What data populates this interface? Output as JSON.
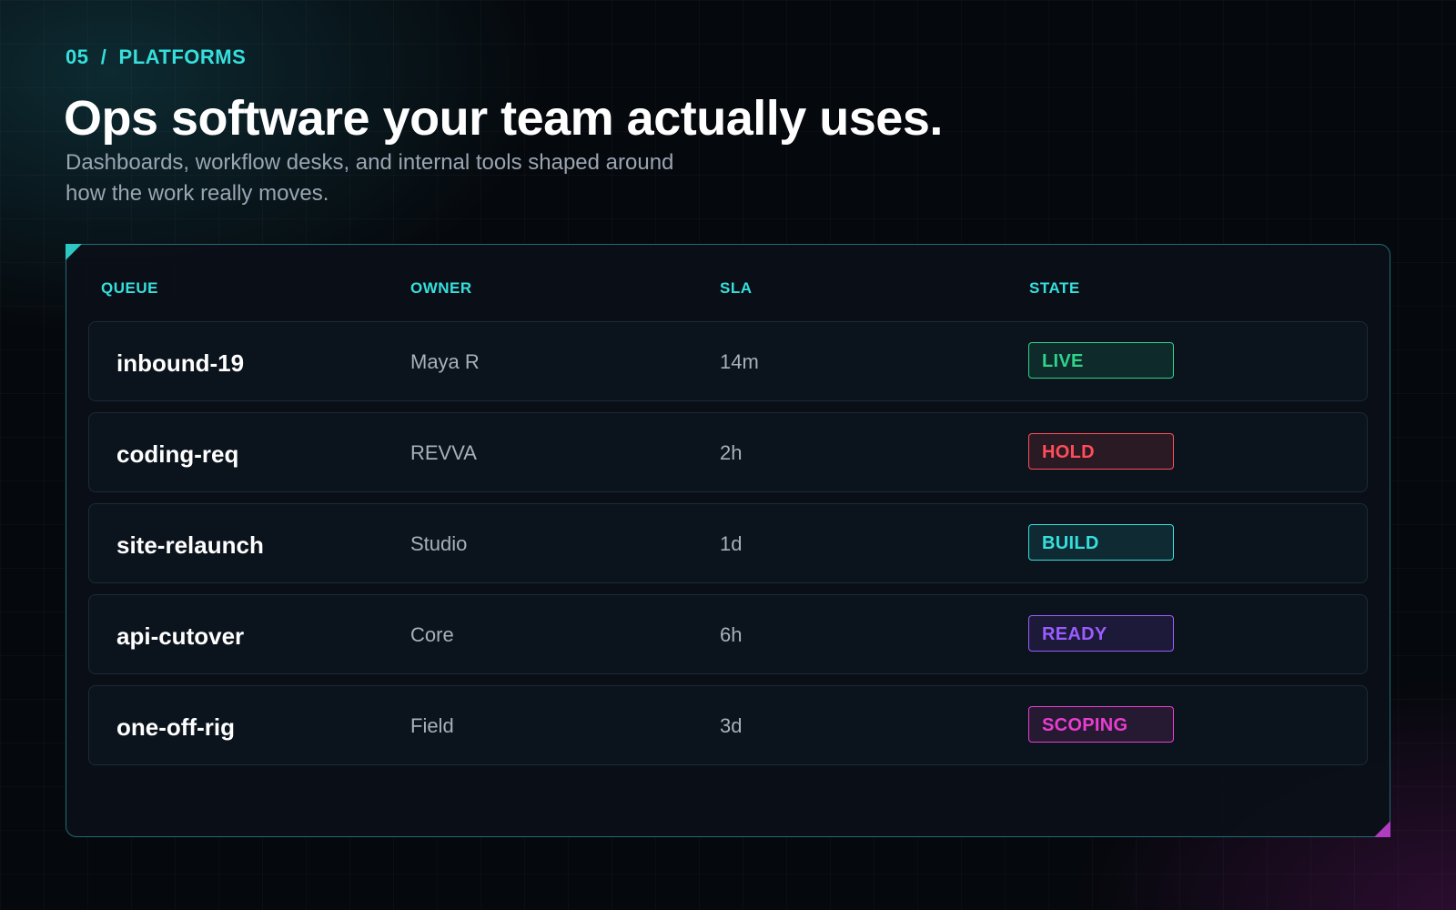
{
  "header": {
    "eyebrow": "05  /  PLATFORMS",
    "title": "Ops software your team actually uses.",
    "subtitle": "Dashboards, workflow desks, and internal tools shaped around how the work really moves."
  },
  "table": {
    "columns": {
      "queue": "QUEUE",
      "owner": "OWNER",
      "sla": "SLA",
      "state": "STATE"
    },
    "rows": [
      {
        "queue": "inbound-19",
        "owner": "Maya R",
        "sla": "14m",
        "state": "LIVE",
        "state_color": "#2fd38a",
        "state_bg": "#0f2a2b"
      },
      {
        "queue": "coding-req",
        "owner": "REVVA",
        "sla": "2h",
        "state": "HOLD",
        "state_color": "#ff4d5a",
        "state_bg": "#2a1a24"
      },
      {
        "queue": "site-relaunch",
        "owner": "Studio",
        "sla": "1d",
        "state": "BUILD",
        "state_color": "#35e0dc",
        "state_bg": "#0f2a33"
      },
      {
        "queue": "api-cutover",
        "owner": "Core",
        "sla": "6h",
        "state": "READY",
        "state_color": "#9a5cff",
        "state_bg": "#1c1a38"
      },
      {
        "queue": "one-off-rig",
        "owner": "Field",
        "sla": "3d",
        "state": "SCOPING",
        "state_color": "#e93dd0",
        "state_bg": "#251a32"
      }
    ]
  },
  "colors": {
    "accent_cyan": "#35e0dc",
    "accent_magenta": "#b03cc0",
    "background": "#05080c",
    "panel_border": "#1f6d72"
  }
}
